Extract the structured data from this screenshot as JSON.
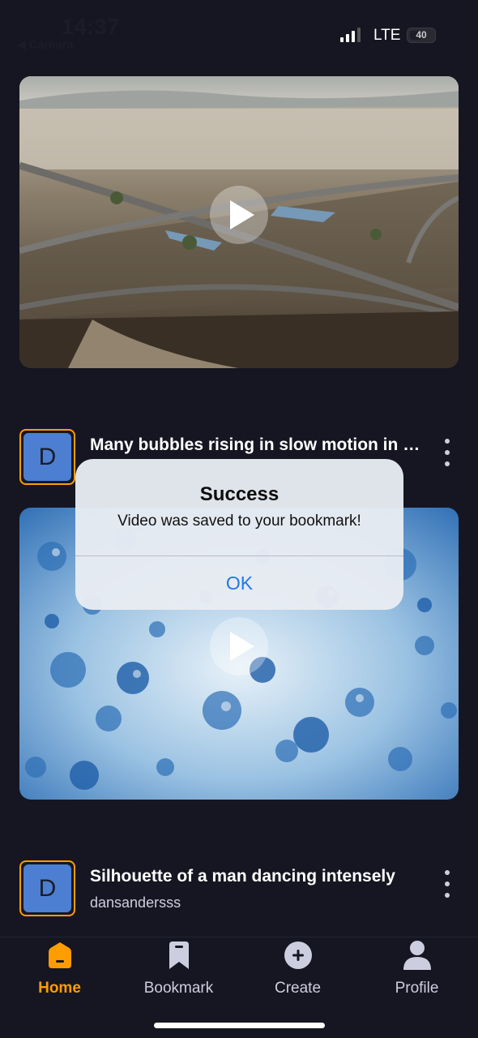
{
  "status_bar": {
    "time": "14:37",
    "back_label": "◀ Cámara",
    "network": "LTE",
    "battery": "40"
  },
  "feed": [
    {
      "title": "",
      "author": ""
    },
    {
      "title": "Many bubbles rising in slow motion in water",
      "author": ""
    },
    {
      "title": "Silhouette of a man dancing intensely",
      "author": "dansandersss"
    }
  ],
  "avatar_initial": "D",
  "alert": {
    "title": "Success",
    "message": "Video was saved to your bookmark!",
    "ok_label": "OK"
  },
  "tabs": [
    {
      "label": "Home",
      "icon": "home-icon",
      "active": true
    },
    {
      "label": "Bookmark",
      "icon": "bookmark-icon",
      "active": false
    },
    {
      "label": "Create",
      "icon": "plus-icon",
      "active": false
    },
    {
      "label": "Profile",
      "icon": "profile-icon",
      "active": false
    }
  ],
  "colors": {
    "background": "#161622",
    "accent": "#ff9c01",
    "avatar": "#4c7fd1",
    "alert_button": "#1f7ae8"
  }
}
